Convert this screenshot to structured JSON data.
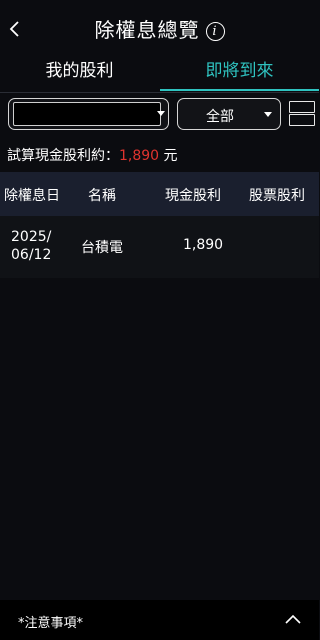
{
  "header": {
    "title": "除權息總覽",
    "back_icon": "chevron-left-icon",
    "info_icon": "info-icon"
  },
  "tabs": [
    {
      "label": "我的股利",
      "active": false
    },
    {
      "label": "即將到來",
      "active": true
    }
  ],
  "filters": {
    "stock_select": {
      "value": ""
    },
    "type_select": {
      "value": "全部"
    },
    "layout_icon": "layout-toggle-icon"
  },
  "estimate": {
    "label": "試算現金股利約：",
    "amount": "1,890",
    "unit": "元"
  },
  "table": {
    "headers": [
      "除權息日",
      "名稱",
      "現金股利",
      "股票股利"
    ],
    "rows": [
      {
        "date_line1": "2025/",
        "date_line2": "06/12",
        "name": "台積電",
        "cash_dividend": "1,890",
        "stock_dividend": ""
      }
    ]
  },
  "footer": {
    "notes_label": "*注意事項*",
    "expand_icon": "chevron-up-icon"
  },
  "colors": {
    "accent": "#2fc3c0",
    "amount": "#e0342f",
    "table_header_bg": "#1a1f2e"
  }
}
